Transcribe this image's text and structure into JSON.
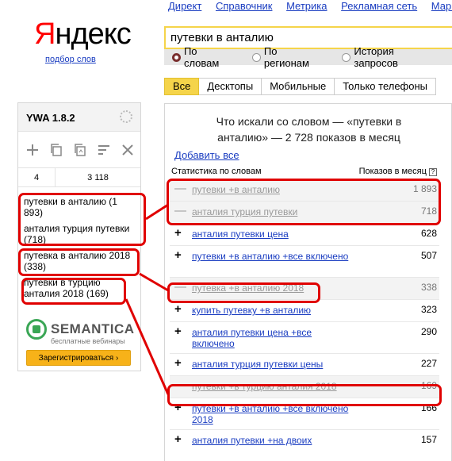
{
  "nav": {
    "links": [
      "Директ",
      "Справочник",
      "Метрика",
      "Рекламная сеть",
      "Маркет"
    ]
  },
  "logo": {
    "first_letter": "Я",
    "rest": "ндекс",
    "subtitle": "подбор слов"
  },
  "search": {
    "query": "путевки в анталию",
    "modes": [
      "По словам",
      "По регионам",
      "История запросов"
    ],
    "selected_mode": "По словам"
  },
  "device_tabs": [
    "Все",
    "Десктопы",
    "Мобильные",
    "Только телефоны"
  ],
  "ywa": {
    "title": "YWA 1.8.2",
    "count_left": "4",
    "count_right": "3 118",
    "list": [
      "путевки в анталию (1 893)",
      "анталия турция путевки (718)",
      "путевка в анталию 2018 (338)",
      "путевки в турцию анталия 2018 (169)"
    ],
    "ad": {
      "title": "SEMANTICA",
      "subtitle": "бесплатные вебинары",
      "button": "Зарегистрироваться ›"
    }
  },
  "results": {
    "heading": "Что искали со словом — «путевки в анталию» — 2 728 показов в месяц",
    "add_all": "Добавить все",
    "col_phrase": "Статистика по словам",
    "col_count": "Показов в месяц",
    "rows": [
      {
        "sign": "—",
        "phrase": "путевки +в анталию",
        "count": "1 893",
        "added": true
      },
      {
        "sign": "—",
        "phrase": "анталия турция путевки",
        "count": "718",
        "added": true
      },
      {
        "sign": "+",
        "phrase": "анталия путевки цена",
        "count": "628",
        "added": false
      },
      {
        "sign": "+",
        "phrase": "путевки +в анталию +все включено",
        "count": "507",
        "added": false
      },
      {
        "sign": "—",
        "phrase": "путевка +в анталию 2018",
        "count": "338",
        "added": true
      },
      {
        "sign": "+",
        "phrase": "купить путевку +в анталию",
        "count": "323",
        "added": false
      },
      {
        "sign": "+",
        "phrase": "анталия путевки цена +все включено",
        "count": "290",
        "added": false
      },
      {
        "sign": "+",
        "phrase": "анталия турция путевки цены",
        "count": "227",
        "added": false
      },
      {
        "sign": "—",
        "phrase": "путевки +в турцию анталия 2018",
        "count": "169",
        "added": true
      },
      {
        "sign": "+",
        "phrase": "путевки +в анталию +все включено 2018",
        "count": "166",
        "added": false
      },
      {
        "sign": "+",
        "phrase": "анталия путевки +на двоих",
        "count": "157",
        "added": false
      }
    ]
  },
  "colors": {
    "link": "#1a3dc1",
    "accent_yellow": "#f5d44a",
    "highlight_red": "#e00000",
    "brand_red": "#ff0000"
  }
}
